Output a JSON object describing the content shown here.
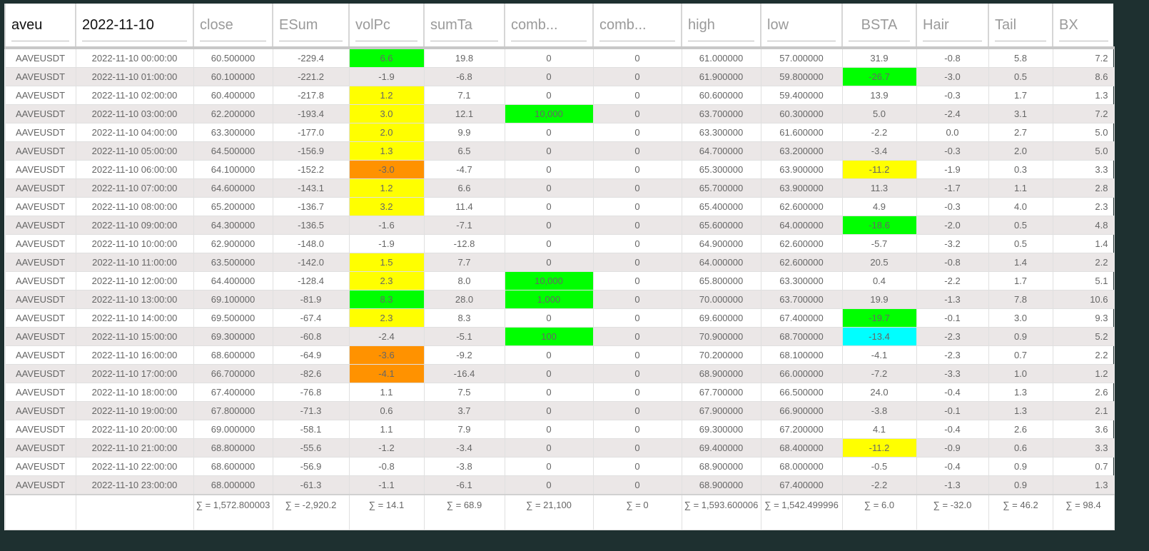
{
  "filters": {
    "symbol": "aveu",
    "date": "2022-11-10"
  },
  "columns": [
    "close",
    "ESum",
    "volPc",
    "sumTa",
    "comb...",
    "comb...",
    "high",
    "low",
    "BSTA",
    "Hair",
    "Tail",
    "BX"
  ],
  "colors": {
    "green": "#00ff00",
    "yellow": "#ffff00",
    "orange": "#ff9200",
    "cyan": "#00ffff"
  },
  "rows": [
    [
      "AAVEUSDT",
      "2022-11-10 00:00:00",
      "60.500000",
      "-229.4",
      "6.6",
      "19.8",
      "0",
      "0",
      "61.000000",
      "57.000000",
      "31.9",
      "-0.8",
      "5.8",
      "7.2"
    ],
    [
      "AAVEUSDT",
      "2022-11-10 01:00:00",
      "60.100000",
      "-221.2",
      "-1.9",
      "-6.8",
      "0",
      "0",
      "61.900000",
      "59.800000",
      "-26.7",
      "-3.0",
      "0.5",
      "8.6"
    ],
    [
      "AAVEUSDT",
      "2022-11-10 02:00:00",
      "60.400000",
      "-217.8",
      "1.2",
      "7.1",
      "0",
      "0",
      "60.600000",
      "59.400000",
      "13.9",
      "-0.3",
      "1.7",
      "1.3"
    ],
    [
      "AAVEUSDT",
      "2022-11-10 03:00:00",
      "62.200000",
      "-193.4",
      "3.0",
      "12.1",
      "10,000",
      "0",
      "63.700000",
      "60.300000",
      "5.0",
      "-2.4",
      "3.1",
      "7.2"
    ],
    [
      "AAVEUSDT",
      "2022-11-10 04:00:00",
      "63.300000",
      "-177.0",
      "2.0",
      "9.9",
      "0",
      "0",
      "63.300000",
      "61.600000",
      "-2.2",
      "0.0",
      "2.7",
      "5.0"
    ],
    [
      "AAVEUSDT",
      "2022-11-10 05:00:00",
      "64.500000",
      "-156.9",
      "1.3",
      "6.5",
      "0",
      "0",
      "64.700000",
      "63.200000",
      "-3.4",
      "-0.3",
      "2.0",
      "5.0"
    ],
    [
      "AAVEUSDT",
      "2022-11-10 06:00:00",
      "64.100000",
      "-152.2",
      "-3.0",
      "-4.7",
      "0",
      "0",
      "65.300000",
      "63.900000",
      "-11.2",
      "-1.9",
      "0.3",
      "3.3"
    ],
    [
      "AAVEUSDT",
      "2022-11-10 07:00:00",
      "64.600000",
      "-143.1",
      "1.2",
      "6.6",
      "0",
      "0",
      "65.700000",
      "63.900000",
      "11.3",
      "-1.7",
      "1.1",
      "2.8"
    ],
    [
      "AAVEUSDT",
      "2022-11-10 08:00:00",
      "65.200000",
      "-136.7",
      "3.2",
      "11.4",
      "0",
      "0",
      "65.400000",
      "62.600000",
      "4.9",
      "-0.3",
      "4.0",
      "2.3"
    ],
    [
      "AAVEUSDT",
      "2022-11-10 09:00:00",
      "64.300000",
      "-136.5",
      "-1.6",
      "-7.1",
      "0",
      "0",
      "65.600000",
      "64.000000",
      "-18.6",
      "-2.0",
      "0.5",
      "4.8"
    ],
    [
      "AAVEUSDT",
      "2022-11-10 10:00:00",
      "62.900000",
      "-148.0",
      "-1.9",
      "-12.8",
      "0",
      "0",
      "64.900000",
      "62.600000",
      "-5.7",
      "-3.2",
      "0.5",
      "1.4"
    ],
    [
      "AAVEUSDT",
      "2022-11-10 11:00:00",
      "63.500000",
      "-142.0",
      "1.5",
      "7.7",
      "0",
      "0",
      "64.000000",
      "62.600000",
      "20.5",
      "-0.8",
      "1.4",
      "2.2"
    ],
    [
      "AAVEUSDT",
      "2022-11-10 12:00:00",
      "64.400000",
      "-128.4",
      "2.3",
      "8.0",
      "10,000",
      "0",
      "65.800000",
      "63.300000",
      "0.4",
      "-2.2",
      "1.7",
      "5.1"
    ],
    [
      "AAVEUSDT",
      "2022-11-10 13:00:00",
      "69.100000",
      "-81.9",
      "8.3",
      "28.0",
      "1,000",
      "0",
      "70.000000",
      "63.700000",
      "19.9",
      "-1.3",
      "7.8",
      "10.6"
    ],
    [
      "AAVEUSDT",
      "2022-11-10 14:00:00",
      "69.500000",
      "-67.4",
      "2.3",
      "8.3",
      "0",
      "0",
      "69.600000",
      "67.400000",
      "-19.7",
      "-0.1",
      "3.0",
      "9.3"
    ],
    [
      "AAVEUSDT",
      "2022-11-10 15:00:00",
      "69.300000",
      "-60.8",
      "-2.4",
      "-5.1",
      "100",
      "0",
      "70.900000",
      "68.700000",
      "-13.4",
      "-2.3",
      "0.9",
      "5.2"
    ],
    [
      "AAVEUSDT",
      "2022-11-10 16:00:00",
      "68.600000",
      "-64.9",
      "-3.6",
      "-9.2",
      "0",
      "0",
      "70.200000",
      "68.100000",
      "-4.1",
      "-2.3",
      "0.7",
      "2.2"
    ],
    [
      "AAVEUSDT",
      "2022-11-10 17:00:00",
      "66.700000",
      "-82.6",
      "-4.1",
      "-16.4",
      "0",
      "0",
      "68.900000",
      "66.000000",
      "-7.2",
      "-3.3",
      "1.0",
      "1.2"
    ],
    [
      "AAVEUSDT",
      "2022-11-10 18:00:00",
      "67.400000",
      "-76.8",
      "1.1",
      "7.5",
      "0",
      "0",
      "67.700000",
      "66.500000",
      "24.0",
      "-0.4",
      "1.3",
      "2.6"
    ],
    [
      "AAVEUSDT",
      "2022-11-10 19:00:00",
      "67.800000",
      "-71.3",
      "0.6",
      "3.7",
      "0",
      "0",
      "67.900000",
      "66.900000",
      "-3.8",
      "-0.1",
      "1.3",
      "2.1"
    ],
    [
      "AAVEUSDT",
      "2022-11-10 20:00:00",
      "69.000000",
      "-58.1",
      "1.1",
      "7.9",
      "0",
      "0",
      "69.300000",
      "67.200000",
      "4.1",
      "-0.4",
      "2.6",
      "3.6"
    ],
    [
      "AAVEUSDT",
      "2022-11-10 21:00:00",
      "68.800000",
      "-55.6",
      "-1.2",
      "-3.4",
      "0",
      "0",
      "69.400000",
      "68.400000",
      "-11.2",
      "-0.9",
      "0.6",
      "3.3"
    ],
    [
      "AAVEUSDT",
      "2022-11-10 22:00:00",
      "68.600000",
      "-56.9",
      "-0.8",
      "-3.8",
      "0",
      "0",
      "68.900000",
      "68.000000",
      "-0.5",
      "-0.4",
      "0.9",
      "0.7"
    ],
    [
      "AAVEUSDT",
      "2022-11-10 23:00:00",
      "68.000000",
      "-61.3",
      "-1.1",
      "-6.1",
      "0",
      "0",
      "68.900000",
      "67.400000",
      "-2.2",
      "-1.3",
      "0.9",
      "1.3"
    ]
  ],
  "highlights": [
    [
      0,
      4,
      "green"
    ],
    [
      1,
      10,
      "green"
    ],
    [
      2,
      4,
      "yellow"
    ],
    [
      3,
      4,
      "yellow"
    ],
    [
      3,
      6,
      "green"
    ],
    [
      4,
      4,
      "yellow"
    ],
    [
      5,
      4,
      "yellow"
    ],
    [
      6,
      4,
      "orange"
    ],
    [
      6,
      10,
      "yellow"
    ],
    [
      7,
      4,
      "yellow"
    ],
    [
      8,
      4,
      "yellow"
    ],
    [
      9,
      10,
      "green"
    ],
    [
      11,
      4,
      "yellow"
    ],
    [
      12,
      4,
      "yellow"
    ],
    [
      12,
      6,
      "green"
    ],
    [
      13,
      4,
      "green"
    ],
    [
      13,
      6,
      "green"
    ],
    [
      14,
      4,
      "yellow"
    ],
    [
      14,
      10,
      "green"
    ],
    [
      15,
      6,
      "green"
    ],
    [
      15,
      10,
      "cyan"
    ],
    [
      16,
      4,
      "orange"
    ],
    [
      17,
      4,
      "orange"
    ],
    [
      21,
      10,
      "yellow"
    ]
  ],
  "totals": [
    "",
    "",
    "∑ = 1,572.800003",
    "∑ = -2,920.2",
    "∑ = 14.1",
    "∑ = 68.9",
    "∑ = 21,100",
    "∑ = 0",
    "∑ = 1,593.600006",
    "∑ = 1,542.499996",
    "∑ = 6.0",
    "∑ = -32.0",
    "∑ = 46.2",
    "∑ = 98.4"
  ]
}
